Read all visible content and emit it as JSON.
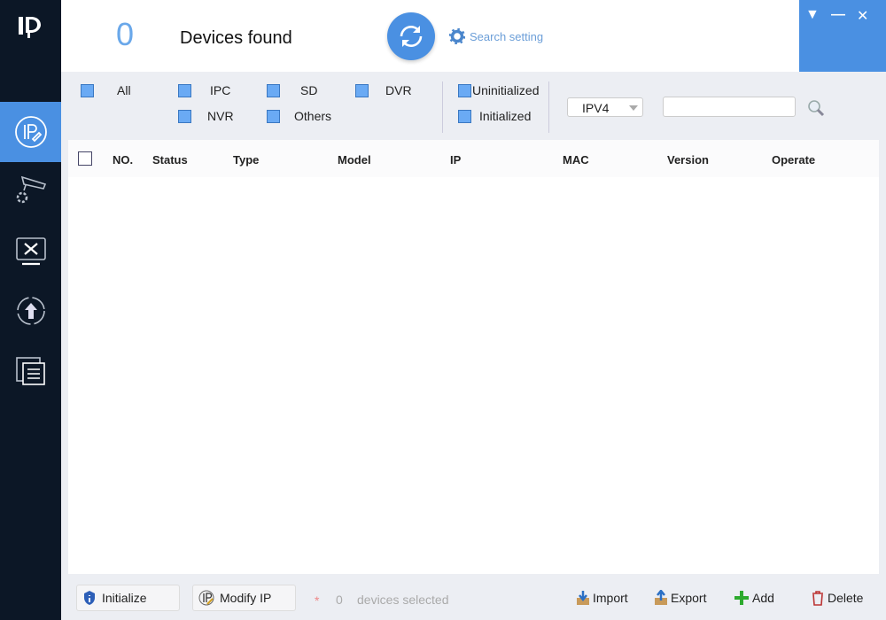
{
  "sidebar": {
    "logo": "lP",
    "items": [
      {
        "name": "ip-config",
        "icon": "ip-edit-icon",
        "active": true
      },
      {
        "name": "device-config",
        "icon": "camera-settings-icon"
      },
      {
        "name": "system-settings",
        "icon": "tools-monitor-icon"
      },
      {
        "name": "upgrade",
        "icon": "upgrade-icon"
      },
      {
        "name": "documents",
        "icon": "documents-icon"
      }
    ]
  },
  "header": {
    "count": "0",
    "label": "Devices found",
    "search_setting": "Search setting"
  },
  "window_controls": {
    "menu": "▼",
    "minimize": "—",
    "close": "✕"
  },
  "filters": {
    "types": [
      "All",
      "IPC",
      "SD",
      "DVR",
      "NVR",
      "Others"
    ],
    "status": [
      "Uninitialized",
      "Initialized"
    ],
    "ip_version": "IPV4",
    "search_value": ""
  },
  "table": {
    "columns": [
      "NO.",
      "Status",
      "Type",
      "Model",
      "IP",
      "MAC",
      "Version",
      "Operate"
    ],
    "rows": []
  },
  "footer": {
    "initialize": "Initialize",
    "modify_ip": "Modify IP",
    "asterisk": "*",
    "selected_count": "0",
    "selected_label": "devices selected",
    "import": "Import",
    "export": "Export",
    "add": "Add",
    "delete": "Delete"
  },
  "colors": {
    "accent": "#4a90e2",
    "sidebar": "#0c1726",
    "checkbox": "#6aaaf4"
  }
}
